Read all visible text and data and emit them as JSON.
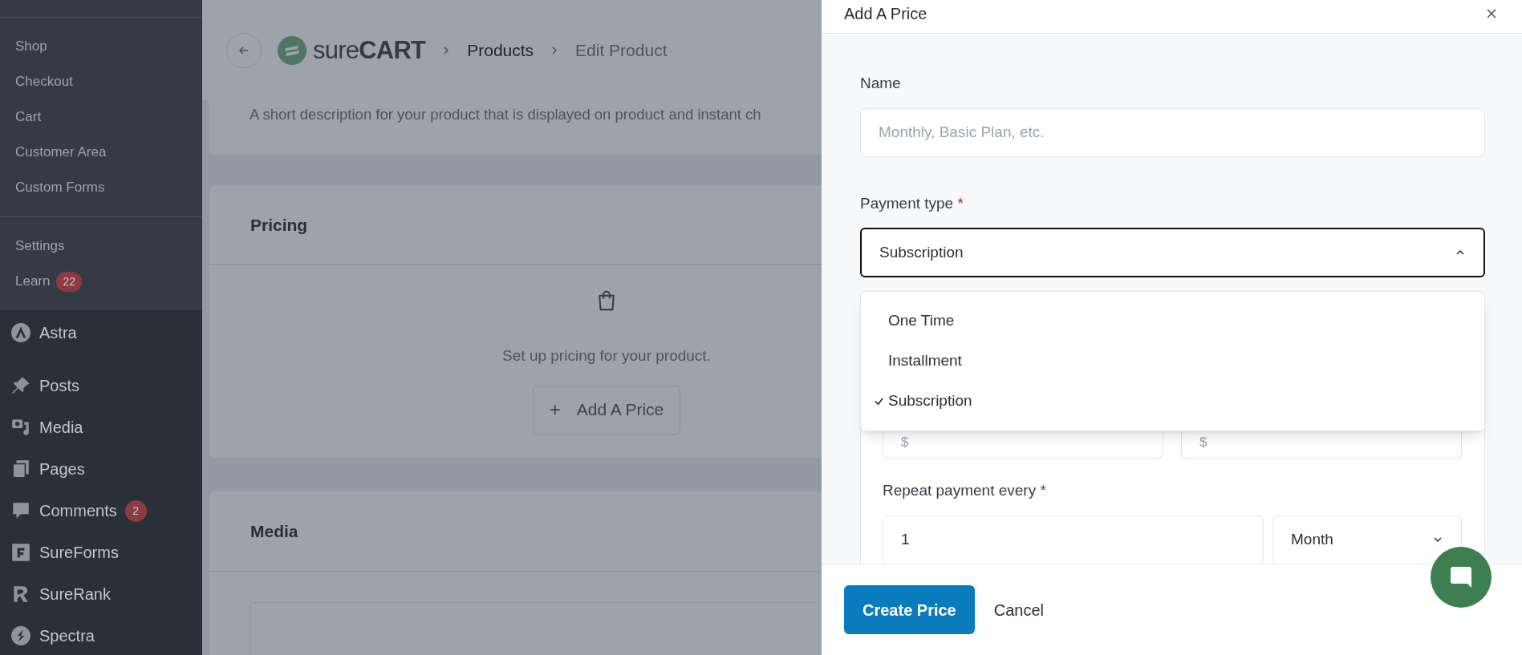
{
  "sidebar": {
    "submenu": [
      {
        "label": "Shop"
      },
      {
        "label": "Checkout"
      },
      {
        "label": "Cart"
      },
      {
        "label": "Customer Area"
      },
      {
        "label": "Custom Forms"
      }
    ],
    "submenu_2": [
      {
        "label": "Settings"
      },
      {
        "label": "Learn",
        "badge": "22"
      }
    ],
    "menu": [
      {
        "label": "Astra",
        "kind": "astra"
      },
      {
        "label": "Posts",
        "kind": "pin"
      },
      {
        "label": "Media",
        "kind": "media"
      },
      {
        "label": "Pages",
        "kind": "pages"
      },
      {
        "label": "Comments",
        "kind": "comment",
        "badge": "2"
      },
      {
        "label": "SureForms",
        "kind": "form"
      },
      {
        "label": "SureRank",
        "kind": "rank"
      },
      {
        "label": "Spectra",
        "kind": "spectra"
      }
    ]
  },
  "header": {
    "logo_text": "sure**CART**",
    "breadcrumbs": [
      {
        "label": "Products",
        "current": false
      },
      {
        "label": "Edit Product",
        "current": true
      }
    ]
  },
  "description_card": {
    "text": "A short description for your product that is displayed on product and instant ch"
  },
  "pricing_card": {
    "title": "Pricing",
    "empty_text": "Set up pricing for your product.",
    "button": {
      "icon": "+",
      "label": "Add A Price"
    }
  },
  "media_card": {
    "title": "Media"
  },
  "modal": {
    "title": "Add A Price",
    "name_field": {
      "label": "Name",
      "placeholder": "Monthly, Basic Plan, etc."
    },
    "payment_type": {
      "label": "Payment type",
      "required_mark": "*",
      "value": "Subscription",
      "expanded": true,
      "options": [
        {
          "label": "One Time",
          "selected": false
        },
        {
          "label": "Installment",
          "selected": false
        },
        {
          "label": "Subscription",
          "selected": true
        }
      ]
    },
    "price_fields": [
      {
        "prefix": "$"
      },
      {
        "prefix": "$"
      }
    ],
    "repeat": {
      "label": "Repeat payment every",
      "required_mark": "*",
      "value": "1",
      "unit": "Month",
      "expanded": false
    },
    "buttons": [
      {
        "label": "Create Price",
        "kind": "primary"
      },
      {
        "label": "Cancel",
        "kind": "link"
      }
    ]
  }
}
